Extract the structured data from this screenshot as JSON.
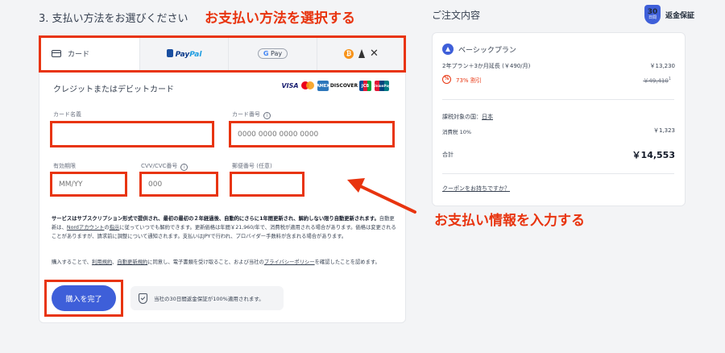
{
  "header": {
    "step_title": "3. 支払い方法をお選びください",
    "order_title": "ご注文内容",
    "guarantee_days": "30",
    "guarantee_unit": "日間",
    "guarantee_label": "返金保証"
  },
  "annotations": {
    "select_method": "お支払い方法を選択する",
    "enter_info": "お支払い情報を入力する"
  },
  "tabs": {
    "card": "カード",
    "paypal_a": "Pay",
    "paypal_b": "Pal",
    "gpay": "Pay",
    "btc_symbol": "₿",
    "xrp_symbol": "✕"
  },
  "form": {
    "section_title": "クレジットまたはデビットカード",
    "brands": {
      "visa": "VISA",
      "amex": "AMEX",
      "discover": "DISCOVER",
      "jcb": "JCB",
      "unionpay": "UnionPay"
    },
    "card_name_label": "カード名義",
    "card_number_label": "カード番号",
    "card_number_placeholder": "0000 0000 0000 0000",
    "expiry_label": "有効期限",
    "expiry_placeholder": "MM/YY",
    "cvv_label": "CVV/CVC番号",
    "cvv_placeholder": "000",
    "postal_label": "郵便番号 (任意)"
  },
  "legal": {
    "bold_text": "サービスはサブスクリプション形式で提供され、最初の最初の２年経過後、自動的にさらに1年間更新され、解約しない限り自動更新されます。",
    "text_a": "自動更新は、",
    "link_nord": "Nordアカウント",
    "text_b": "の",
    "link_notice": "指示",
    "text_c": "に従っていつでも解約できます。更新価格は年間￥21,960/年で、消費税が適用される場合があります。価格は変更されることがありますが、請求前に調整について通知されます。支払いはJPYで行われ、プロバイダー手数料が含まれる場合があります。",
    "consent_a": "購入することで、",
    "link_terms": "利用規約",
    "consent_b": "、",
    "link_renewal": "自動更新規約",
    "consent_c": "に同意し、電子書類を受け取ること、および当社の",
    "link_privacy": "プライバシーポリシー",
    "consent_d": "を確認したことを認めます。"
  },
  "actions": {
    "buy_label": "購入を完了",
    "guarantee_note": "当社の30日間返金保証が100%適用されます。"
  },
  "order": {
    "plan_name": "ベーシックプラン",
    "plan_detail": "2年プラン＋3か月延長 (￥490/月)",
    "plan_price": "￥13,230",
    "discount_label": "73% 割引",
    "discount_icon": "%",
    "original_price": "￥49,410",
    "original_note": "1",
    "tax_country_label": "課税対象の国：",
    "tax_country": "日本",
    "tax_label": "消費税 10%",
    "tax_amount": "￥1,323",
    "total_label": "合計",
    "total_amount": "￥14,553",
    "coupon_link": "クーポンをお持ちですか？"
  },
  "colors": {
    "accent": "#3e5fd9",
    "annotation": "#e8340f"
  }
}
